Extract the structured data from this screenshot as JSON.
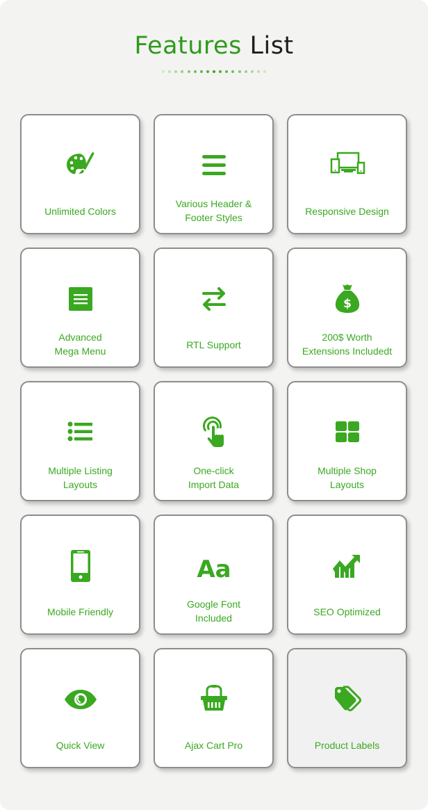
{
  "header": {
    "title_part1": "Features",
    "title_part2": "List",
    "divider_dots": 17
  },
  "colors": {
    "accent": "#3aa820",
    "title_green": "#2f9a1c",
    "title_dark": "#1e1e1e",
    "background": "#f3f3f1",
    "card_border": "#8d8d8d"
  },
  "features": [
    {
      "icon": "palette-icon",
      "line1": "Unlimited Colors",
      "line2": ""
    },
    {
      "icon": "hamburger-menu-icon",
      "line1": "Various Header &",
      "line2": "Footer Styles"
    },
    {
      "icon": "responsive-devices-icon",
      "line1": "Responsive Design",
      "line2": ""
    },
    {
      "icon": "menu-square-icon",
      "line1": "Advanced",
      "line2": "Mega Menu"
    },
    {
      "icon": "exchange-arrows-icon",
      "line1": "RTL Support",
      "line2": ""
    },
    {
      "icon": "money-bag-icon",
      "line1": "200$ Worth",
      "line2": "Extensions Includedt"
    },
    {
      "icon": "list-icon",
      "line1": "Multiple Listing",
      "line2": "Layouts"
    },
    {
      "icon": "tap-hand-icon",
      "line1": "One-click",
      "line2": "Import Data"
    },
    {
      "icon": "grid-icon",
      "line1": "Multiple Shop",
      "line2": "Layouts"
    },
    {
      "icon": "mobile-phone-icon",
      "line1": "Mobile Friendly",
      "line2": ""
    },
    {
      "icon": "font-icon",
      "line1": "Google Font",
      "line2": "Included",
      "glyph": "Aa"
    },
    {
      "icon": "growth-chart-icon",
      "line1": "SEO Optimized",
      "line2": ""
    },
    {
      "icon": "eye-icon",
      "line1": "Quick View",
      "line2": ""
    },
    {
      "icon": "basket-icon",
      "line1": "Ajax Cart Pro",
      "line2": ""
    },
    {
      "icon": "tags-icon",
      "line1": "Product Labels",
      "line2": "",
      "active": true
    }
  ]
}
